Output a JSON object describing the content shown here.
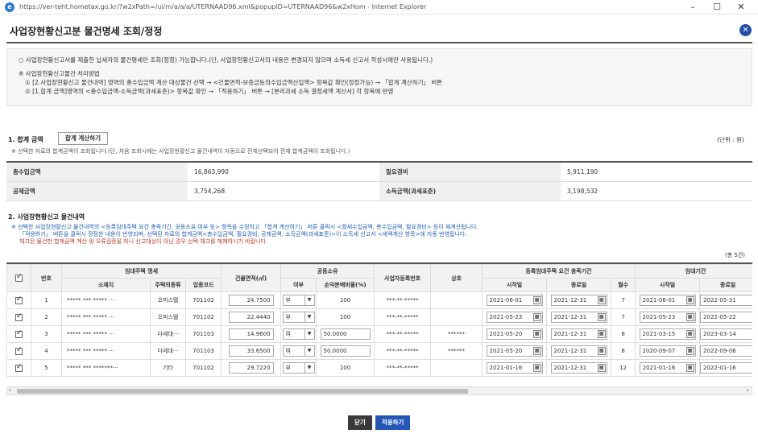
{
  "window": {
    "url": "https://ver-teht.hometax.go.kr/?w2xPath=/ui/m/a/a/a/UTERNAAD96.xml&popupID=UTERNAAD96&w2xHom - Internet Explorer",
    "minimize": "–",
    "maximize": "☐",
    "close": "✕"
  },
  "popup": {
    "title": "사업장현황신고분 물건명세 조회/정정",
    "close_icon": "✕"
  },
  "notice": {
    "line1": "○ 사업장현황신고서를 제출한 납세자의 물건명세만 조회(정정) 가능합니다.(단, 사업장현황신고서의 내용은 변경되지 않으며 소득세 신고서 작성시에만 사용됩니다.)",
    "line2": "※ 사업장현황신고물건 처리방법",
    "line3": "① [2.사업장현황신고 물건내역] 영역의 총수입금액 계산 대상물건 선택 → <건물면적-보증금등의수입금액산입액> 항목값 확인(정정가능) → 「합계 계산하기」 버튼",
    "line4": "② [1.합계 금액]영역의 <총수입금액-소득금액(과세표준)> 항목값 확인 → 「적용하기」 버튼 → [분리과세 소득 결정세액 계산서] 각 항목에 반영"
  },
  "section1": {
    "title": "1. 합계 금액",
    "calc_button": "합계 계산하기",
    "unit": "(단위 : 원)",
    "note": "※ 선택한 자료의 합계금액이 조회됩니다.(단, 처음 조회시에는 사업장현황신고 물건내역이 자동으로 전체선택되어 전체 합계금액이 조회됩니다.)",
    "rows": [
      {
        "label1": "총수입금액",
        "value1": "16,863,990",
        "label2": "필요경비",
        "value2": "5,911,190"
      },
      {
        "label1": "공제금액",
        "value1": "3,754,268",
        "label2": "소득금액(과세표준)",
        "value2": "3,198,532"
      }
    ]
  },
  "section2": {
    "title": "2. 사업장현황신고 물건내역",
    "note1": "※ 선택한 사업장현황신고 물건내역의 <등록임대주택 요건 충족기간, 공동소유 여부 등> 항목을 수정하고 「합계 계산하기」 버튼 클릭시 <월세수입금액, 총수입금액, 필요경비> 등이 재계산됩니다.",
    "note2": "「적용하기」 버튼을 클릭시 정정한 내용이 반영되며, 선택된 자료의 합계금액<총수입금액, 필요경비, 공제금액, 소득금액(과세표준)>이 소득세 신고서 <세액계산 항목>에 자동 반영됩니다.",
    "note3": "체크된 물건만 합계금액 계산 및 오류검증을 하니 신고대상이 아닌 경우 선택 체크를 해제하시기 바랍니다.",
    "count": "(총 5건)"
  },
  "grid": {
    "headers_top": {
      "no": "번호",
      "rental_detail": "임대주택 명세",
      "area": "건물면적(㎡)",
      "joint": "공동소유",
      "bizno": "사업자등록번호",
      "company": "상호",
      "reg_period": "등록임대주택 요건 충족기간",
      "rent_period": "임대기간"
    },
    "headers_sub": {
      "address": "소재지",
      "house_type": "주택의종류",
      "biz_code": "업종코드",
      "joint_yn": "여부",
      "share": "손익분배비율(%)",
      "start": "시작일",
      "end": "종료일",
      "months": "월수",
      "rent_start": "시작일",
      "rent_end": "종료일"
    },
    "rows": [
      {
        "no": "1",
        "address": "***** *** ***** ···",
        "type": "오피스텔",
        "code": "701102",
        "area": "24.7500",
        "joint": "부",
        "share": "100",
        "bizno": "***-**-*****",
        "company": "",
        "start": "2021-06-01",
        "end": "2021-12-31",
        "months": "7",
        "rent_start": "2021-06-01",
        "rent_end": "2022-05-31"
      },
      {
        "no": "2",
        "address": "***** *** ***** ···",
        "type": "오피스텔",
        "code": "701102",
        "area": "22.4440",
        "joint": "부",
        "share": "100",
        "bizno": "***-**-*****",
        "company": "",
        "start": "2021-05-23",
        "end": "2021-12-31",
        "months": "7",
        "rent_start": "2021-05-23",
        "rent_end": "2022-05-22"
      },
      {
        "no": "3",
        "address": "***** *** ***** ···",
        "type": "다세대···",
        "code": "701103",
        "area": "14.9600",
        "joint": "여",
        "share": "50.0000",
        "bizno": "***-**-*****",
        "company": "******",
        "start": "2021-05-20",
        "end": "2021-12-31",
        "months": "8",
        "rent_start": "2021-03-15",
        "rent_end": "2023-03-14"
      },
      {
        "no": "4",
        "address": "***** *** ***** ···",
        "type": "다세대···",
        "code": "701103",
        "area": "33.6500",
        "joint": "여",
        "share": "50.0000",
        "bizno": "***-**-*****",
        "company": "******",
        "start": "2021-05-20",
        "end": "2021-12-31",
        "months": "8",
        "rent_start": "2020-09-07",
        "rent_end": "2022-09-06"
      },
      {
        "no": "5",
        "address": "***** *** *******···",
        "type": "기타",
        "code": "701102",
        "area": "29.7220",
        "joint": "부",
        "share": "100",
        "bizno": "***-**-*****",
        "company": "",
        "start": "2021-01-16",
        "end": "2021-12-31",
        "months": "12",
        "rent_start": "2021-01-16",
        "rent_end": "2022-01-16"
      }
    ]
  },
  "scroll": {
    "left": "‹",
    "right": "›"
  },
  "buttons": {
    "close": "닫기",
    "apply": "적용하기"
  }
}
